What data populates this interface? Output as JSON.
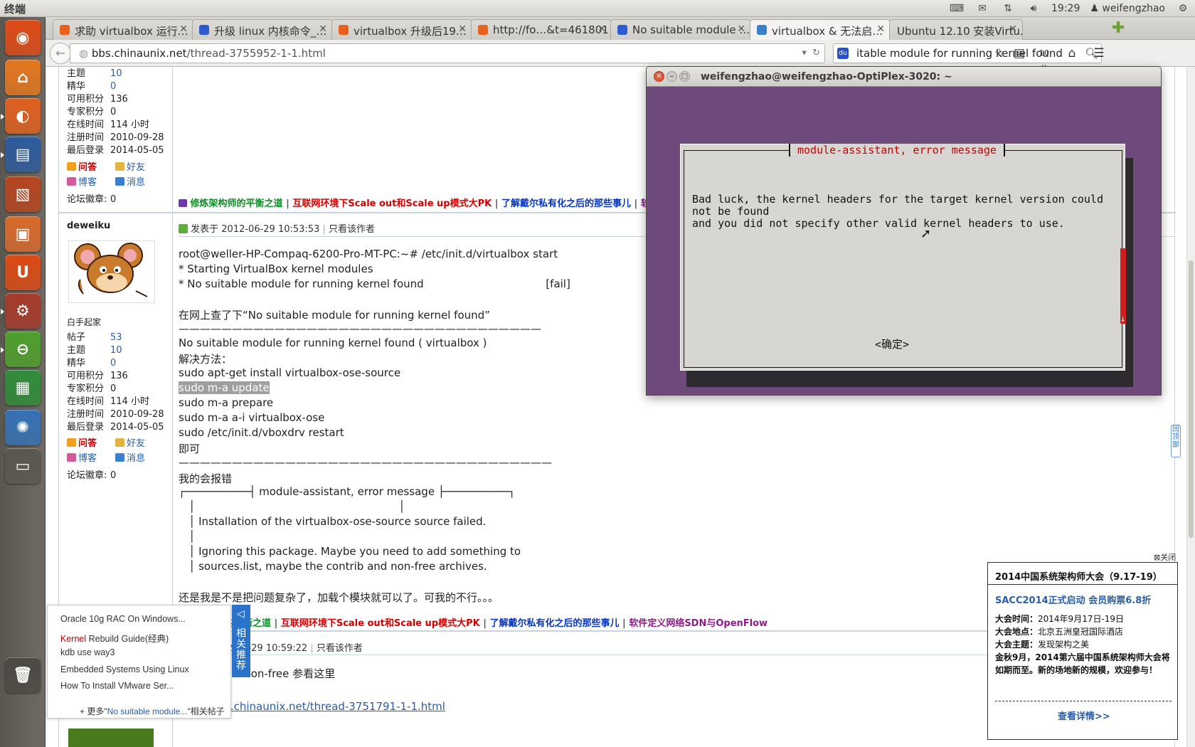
{
  "top_panel": {
    "app_title": "终端",
    "time": "19:29",
    "user": "weifengzhao"
  },
  "launcher": [
    {
      "name": "dash",
      "color": "#df4a16"
    },
    {
      "name": "files",
      "color": "#e4771f"
    },
    {
      "name": "firefox",
      "color": "#e06020"
    },
    {
      "name": "writer",
      "color": "#2c5b9e"
    },
    {
      "name": "impress",
      "color": "#b7451f"
    },
    {
      "name": "software-center",
      "color": "#d96a2b"
    },
    {
      "name": "ubuntu-one",
      "color": "#dd4a14"
    },
    {
      "name": "system-settings",
      "color": "#a73a2a"
    },
    {
      "name": "unknown-app",
      "color": "#4ea02b"
    },
    {
      "name": "calc",
      "color": "#2f8c39"
    },
    {
      "name": "network",
      "color": "#3571b5"
    },
    {
      "name": "workspaces",
      "color": "#5b564f"
    },
    {
      "name": "trash",
      "color": "#4c4944"
    }
  ],
  "tabs": [
    {
      "label": "求助 virtualbox 运行…",
      "fav": "#e8611d"
    },
    {
      "label": "升级 linux 内核命令_…",
      "fav": "#2f5bd0"
    },
    {
      "label": "virtualbox 升级后19…",
      "fav": "#e8611d"
    },
    {
      "label": "http://fo…&t=461801",
      "fav": "#e8611d"
    },
    {
      "label": "No suitable module …",
      "fav": "#2f5bd0"
    },
    {
      "label": "virtualbox & 无法启…",
      "fav": "#3d80c9"
    },
    {
      "label": "Ubuntu 12.10 安装Virtu…",
      "fav": ""
    }
  ],
  "navbar": {
    "url_domain": "bbs.chinaunix.net",
    "url_path": "/thread-3755952-1-1.html",
    "search_value": "itable module for running kernel found"
  },
  "user1_stats": [
    {
      "k": "主题",
      "v": "10",
      "link": true
    },
    {
      "k": "精华",
      "v": "0",
      "link": true
    },
    {
      "k": "可用积分",
      "v": "136",
      "link": false
    },
    {
      "k": "专家积分",
      "v": "0",
      "link": false
    },
    {
      "k": "在线时间",
      "v": "114 小时",
      "link": false
    },
    {
      "k": "注册时间",
      "v": "2010-09-28",
      "link": false
    },
    {
      "k": "最后登录",
      "v": "2014-05-05",
      "link": false
    }
  ],
  "actions": {
    "ask": "问答",
    "friend": "好友",
    "blog": "博客",
    "msg": "消息"
  },
  "medal": {
    "k": "论坛徽章:",
    "v": "0"
  },
  "banner": {
    "a": "修炼架构师的平衡之道",
    "b": "互联网环境下Scale out和Scale up模式大PK",
    "c": "了解戴尔私有化之后的那些事儿",
    "d": "软件定义网络SDN与OpenFlow",
    "d_short": "软"
  },
  "user2": {
    "name": "deweiku",
    "title": "白手起家",
    "stats": [
      {
        "k": "帖子",
        "v": "53",
        "link": true
      },
      {
        "k": "主题",
        "v": "10",
        "link": true
      },
      {
        "k": "精华",
        "v": "0",
        "link": true
      },
      {
        "k": "可用积分",
        "v": "136",
        "link": false
      },
      {
        "k": "专家积分",
        "v": "0",
        "link": false
      },
      {
        "k": "在线时间",
        "v": "114 小时",
        "link": false
      },
      {
        "k": "注册时间",
        "v": "2010-09-28",
        "link": false
      },
      {
        "k": "最后登录",
        "v": "2014-05-05",
        "link": false
      }
    ]
  },
  "post1": {
    "posted": "发表于 2012-06-29 10:53:53",
    "only_author": "只看该作者",
    "lines": [
      "root@weller-HP-Compaq-6200-Pro-MT-PC:~# /etc/init.d/virtualbox start",
      "* Starting VirtualBox kernel modules",
      "* No suitable module for running kernel found                                    [fail]",
      "",
      "在网上查了下“No suitable module for running kernel found”",
      "——————————————————————————————————",
      "No suitable module for running kernel found ( virtualbox )",
      "解决方法：",
      "sudo apt-get install virtualbox-ose-source",
      "sudo m-a update",
      "sudo m-a prepare",
      "sudo m-a a-i virtualbox-ose",
      "sudo /etc/init.d/vboxdrv restart",
      "即可",
      "———————————————————————————————————",
      "我的会报错",
      "┌──────────┤ module-assistant, error message ├──────────┐",
      "   │                                                            │",
      "   │ Installation of the virtualbox-ose-source source failed.",
      "   │",
      "   │ Ignoring this package. Maybe you need to add something to",
      "   │ sources.list, maybe the contrib and non-free archives.",
      "",
      "还是我是不是把问题复杂了，加载个模块就可以了。可我的不行。。。"
    ]
  },
  "post2": {
    "posted": "发表于 2012-06-29 10:59:22",
    "only_author": "只看该作者",
    "line": "添加 contrib non-free 参看这里",
    "link": "http://bbs.chinaunix.net/thread-3751791-1-1.html"
  },
  "terminal": {
    "title": "weifengzhao@weifengzhao-OptiPlex-3020: ~",
    "dialog_title": "module-assistant, error message",
    "msg1": "Bad luck, the kernel headers for the target kernel version could",
    "msg2": "not be found",
    "msg3": "and you did not specify other valid kernel headers to use.",
    "ok": "<确定>"
  },
  "ad": {
    "close": "关闭",
    "header": "2014中国系统架构师大会（9.17-19）",
    "sub": "SACC2014正式启动 会员购票6.8折",
    "time_k": "大会时间：",
    "time_v": "2014年9月17日-19日",
    "place_k": "大会地点：",
    "place_v": "北京五洲皇冠国际酒店",
    "theme_k": "大会主题：",
    "theme_v": "发现架构之美",
    "desc": "金秋9月，2014第六届中国系统架构师大会将如期而至。新的场地新的规模，欢迎参与！",
    "more": "查看详情>>"
  },
  "related": {
    "tab": "相关推荐",
    "items": [
      {
        "pre": "",
        "text": "Oracle 10g RAC On Windows..."
      },
      {
        "pre": "Kernel",
        "text": " Rebuild Guide(经典)"
      },
      {
        "pre": "",
        "text": "kdb use way3"
      },
      {
        "pre": "",
        "text": "Embedded Systems Using Linux"
      },
      {
        "pre": "",
        "text": "How To Install VMware Ser..."
      }
    ],
    "more_prefix": "+ 更多\"",
    "more_link": "No suitable module...",
    "more_suffix": "\"相关帖子"
  },
  "back_top": "回顶部"
}
